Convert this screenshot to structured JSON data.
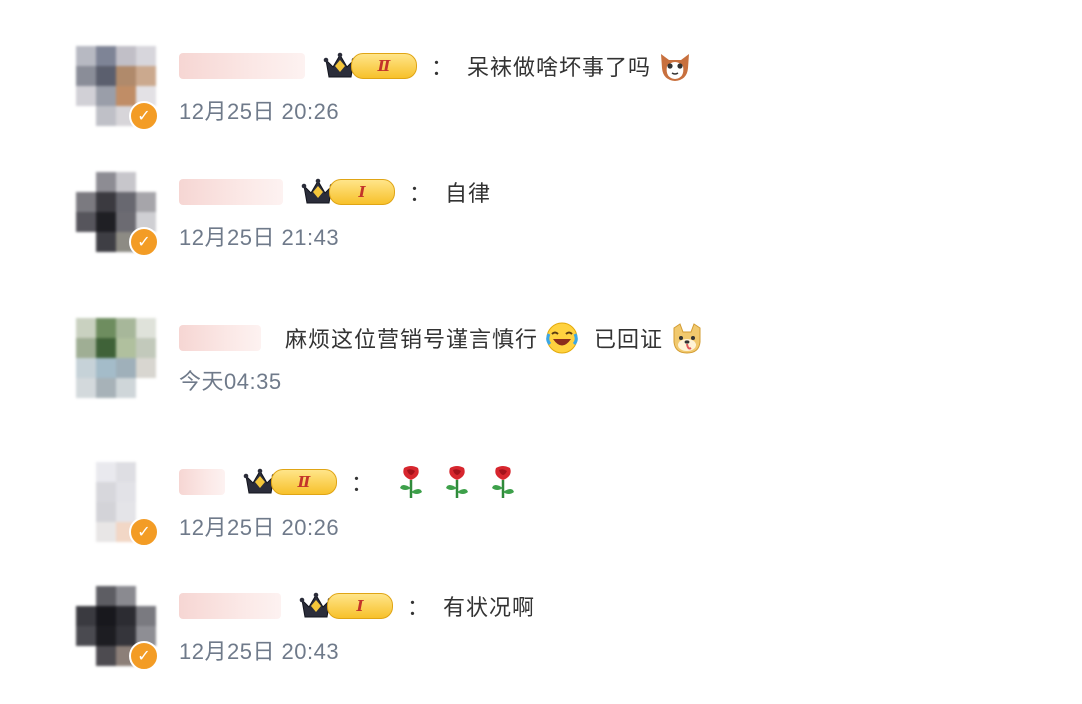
{
  "comments": [
    {
      "username": "",
      "level": "Ⅱ",
      "separator": "：",
      "text": "呆袜做啥坏事了吗",
      "emojis": [
        "cat-face"
      ],
      "time": "12月25日 20:26",
      "avatar_colors": [
        "#b7b9c2",
        "#7e8496",
        "#c1bfc7",
        "#d7d6dc",
        "#8a8d98",
        "#5b5f6e",
        "#b08a6b",
        "#cba98e",
        "#d1d0d6",
        "#9a9ea9",
        "#c08d66",
        "#e3e1e5",
        "#ffffff",
        "#bfc0c7",
        "#d7d5d9",
        "#ffffff"
      ]
    },
    {
      "username": "",
      "level": "Ⅰ",
      "separator": "：",
      "text": "自律",
      "emojis": [],
      "time": "12月25日 21:43",
      "avatar_colors": [
        "#ffffff",
        "#8d8c93",
        "#c7c6cb",
        "#ffffff",
        "#7b7a80",
        "#3b3a40",
        "#686870",
        "#a6a5aa",
        "#56555c",
        "#1f1f24",
        "#6c6b72",
        "#cfcfd3",
        "#ffffff",
        "#3e3e44",
        "#8d8b84",
        "#ffffff"
      ]
    },
    {
      "username": "",
      "level": "",
      "separator": "",
      "text": "麻烦这位营销号谨言慎行",
      "emojis": [
        "laugh-cry",
        "doge"
      ],
      "text2": "已回证",
      "time": "今天04:35",
      "avatar_colors": [
        "#c9d1c0",
        "#6e8d5f",
        "#a7b79a",
        "#dfe2da",
        "#9fae94",
        "#3f6238",
        "#b0c09e",
        "#c2c9bb",
        "#c6d2d8",
        "#a4bcc9",
        "#9fb0ba",
        "#d8d6d0",
        "#d3d9dc",
        "#a7b2b8",
        "#cfd6d9",
        "#ffffff"
      ]
    },
    {
      "username": "",
      "level": "Ⅱ",
      "separator": "：",
      "text": "",
      "emojis": [
        "rose",
        "rose",
        "rose"
      ],
      "time": "12月25日 20:26",
      "avatar_colors": [
        "#ffffff",
        "#e9e9ee",
        "#dedee3",
        "#ffffff",
        "#ffffff",
        "#d7d7dc",
        "#e2e2e7",
        "#ffffff",
        "#ffffff",
        "#d3d3d8",
        "#e4e4e8",
        "#ffffff",
        "#ffffff",
        "#e8e6e6",
        "#f2d7c6",
        "#ffffff"
      ]
    },
    {
      "username": "",
      "level": "Ⅰ",
      "separator": "：",
      "text": "有状况啊",
      "emojis": [],
      "time": "12月25日 20:43",
      "avatar_colors": [
        "#ffffff",
        "#5d5d63",
        "#8a8a90",
        "#ffffff",
        "#3a3a40",
        "#18181d",
        "#2c2c32",
        "#7a7a80",
        "#4a4a50",
        "#1d1d22",
        "#35353b",
        "#8e8e94",
        "#ffffff",
        "#4d4b50",
        "#8c7f78",
        "#ffffff"
      ]
    }
  ],
  "colors": {
    "verified_badge": "#f39c25",
    "time_text": "#6f7a8a",
    "level_badge": "#f7c12b",
    "level_text": "#c3342a"
  }
}
